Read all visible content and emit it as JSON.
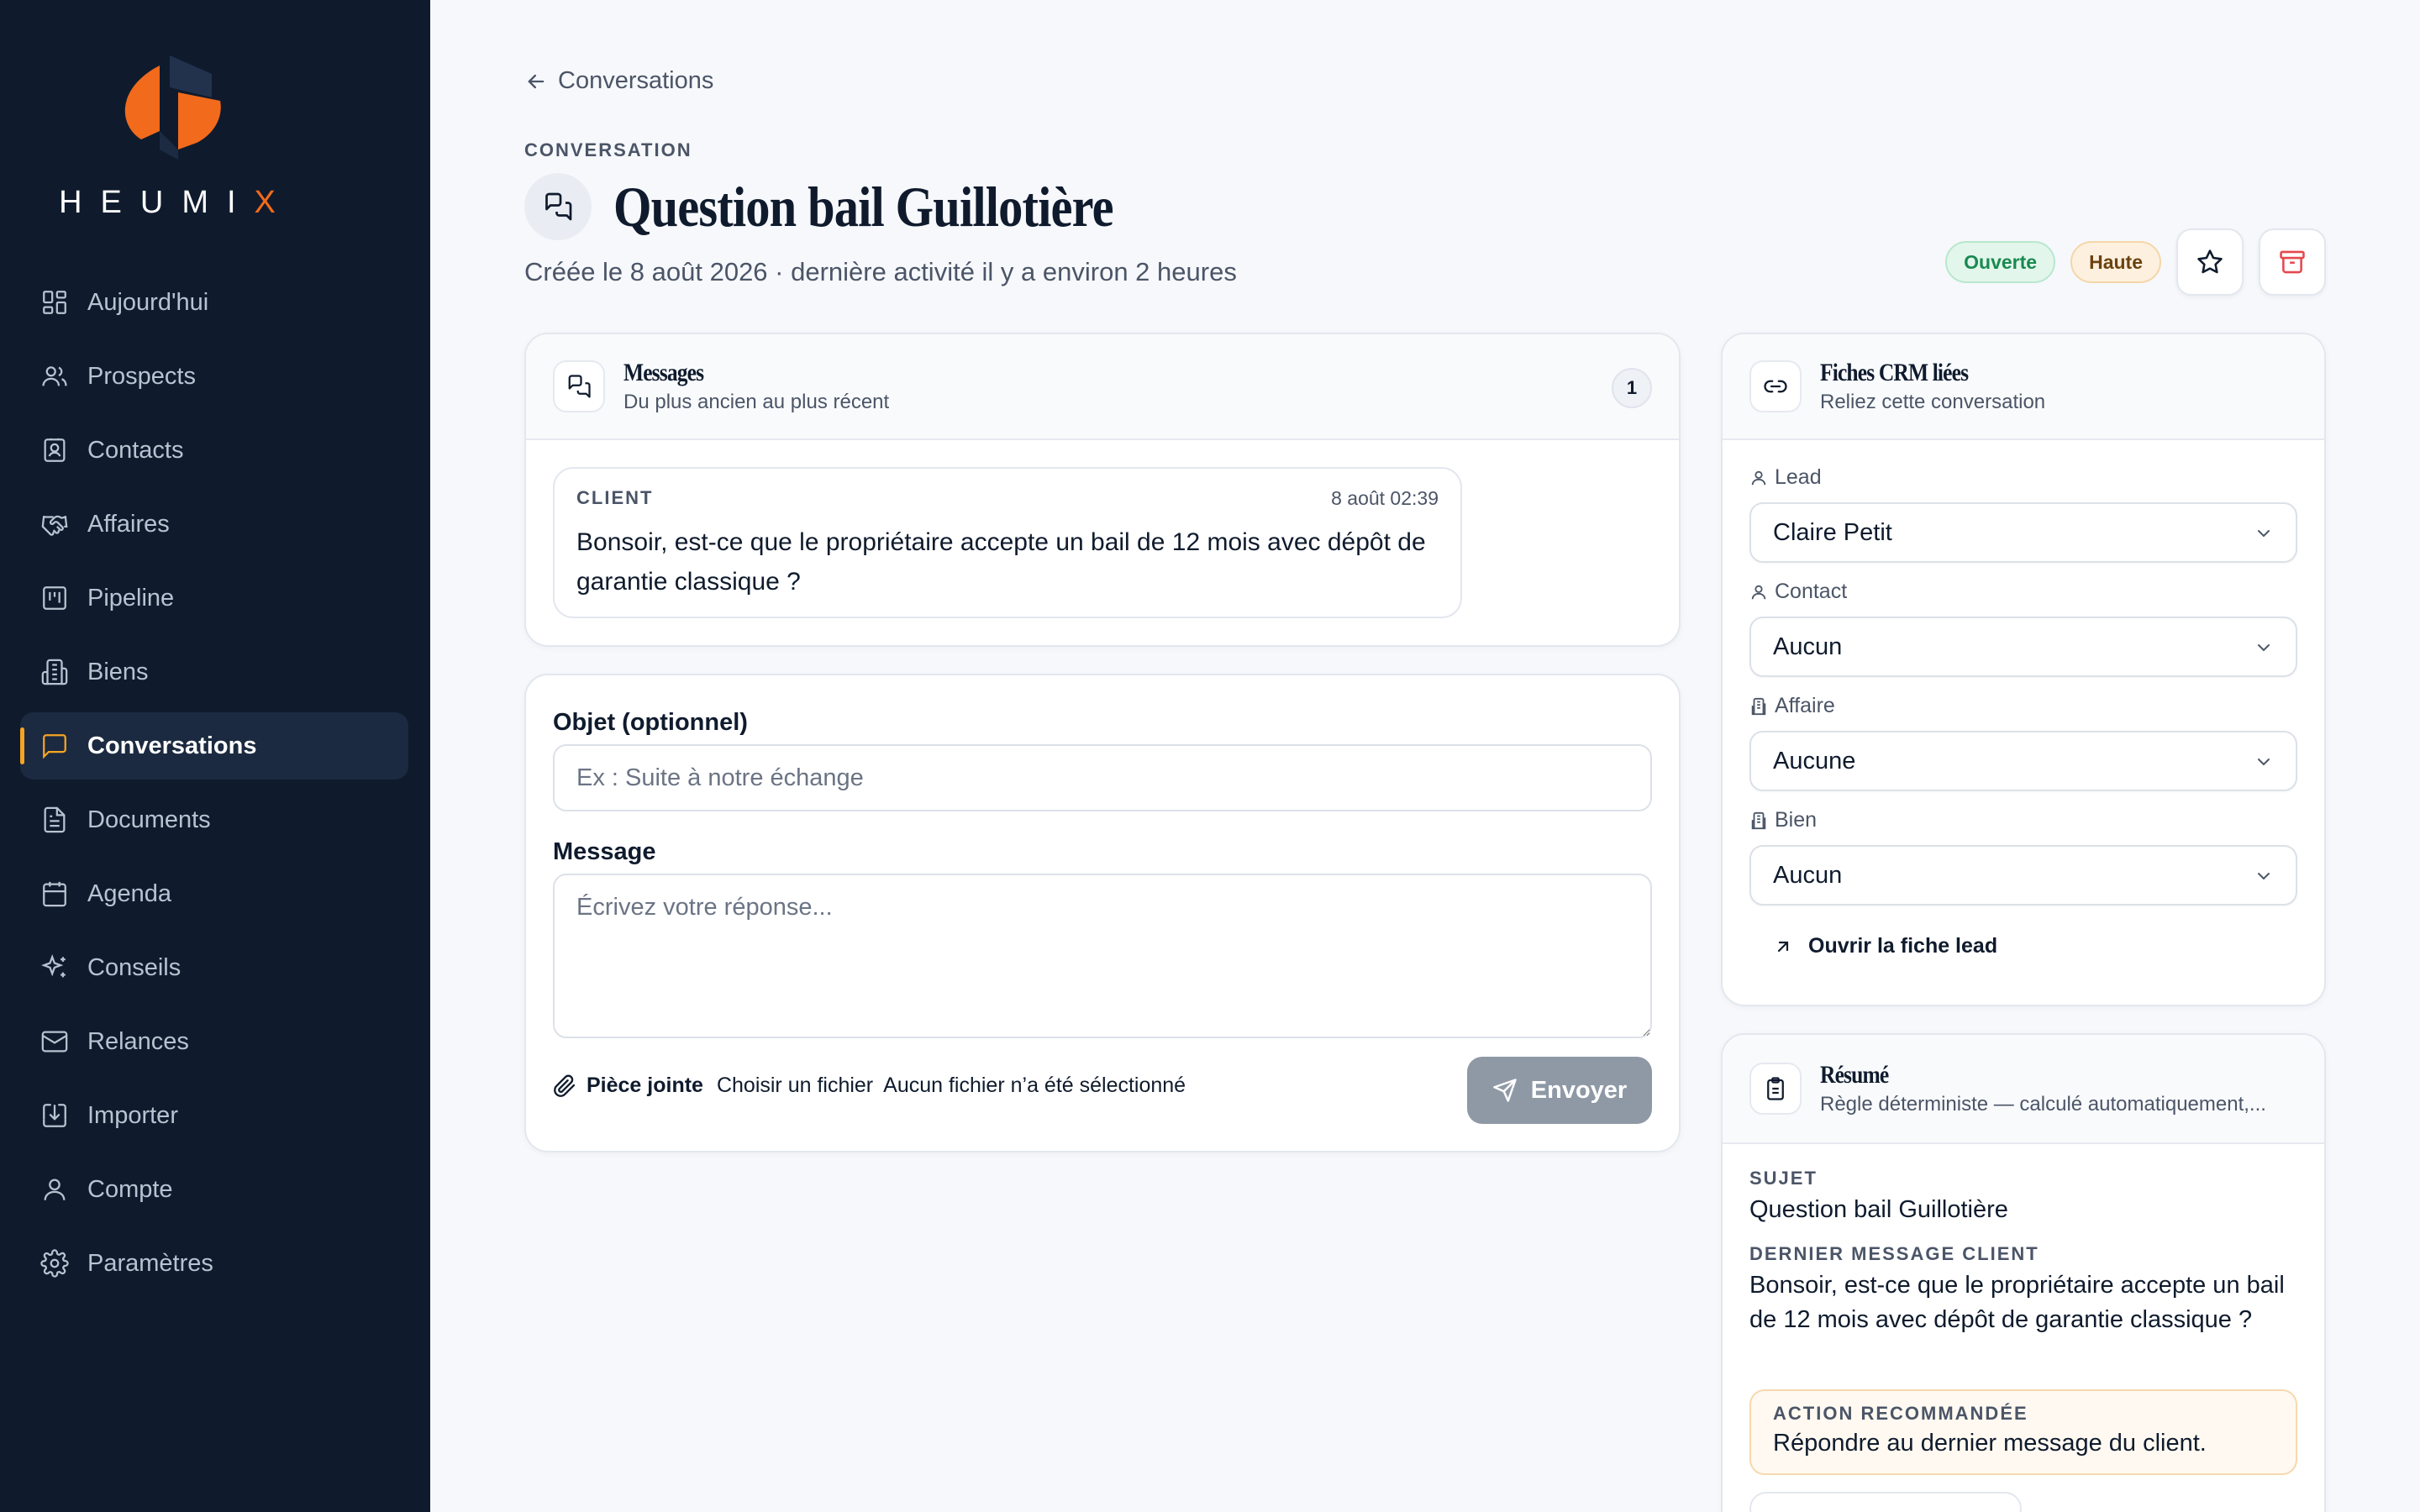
{
  "brand": {
    "name_main": "HEUMI",
    "name_accent": "X",
    "accent_color": "#f26a1b"
  },
  "sidebar": {
    "items": [
      {
        "label": "Aujourd'hui",
        "icon": "dashboard-icon",
        "active": false
      },
      {
        "label": "Prospects",
        "icon": "users-icon",
        "active": false
      },
      {
        "label": "Contacts",
        "icon": "contact-card-icon",
        "active": false
      },
      {
        "label": "Affaires",
        "icon": "handshake-icon",
        "active": false
      },
      {
        "label": "Pipeline",
        "icon": "kanban-icon",
        "active": false
      },
      {
        "label": "Biens",
        "icon": "building-icon",
        "active": false
      },
      {
        "label": "Conversations",
        "icon": "chat-icon",
        "active": true
      },
      {
        "label": "Documents",
        "icon": "document-icon",
        "active": false
      },
      {
        "label": "Agenda",
        "icon": "calendar-icon",
        "active": false
      },
      {
        "label": "Conseils",
        "icon": "sparkles-icon",
        "active": false
      },
      {
        "label": "Relances",
        "icon": "mail-icon",
        "active": false
      },
      {
        "label": "Importer",
        "icon": "import-icon",
        "active": false
      },
      {
        "label": "Compte",
        "icon": "user-icon",
        "active": false
      },
      {
        "label": "Paramètres",
        "icon": "gear-icon",
        "active": false
      }
    ]
  },
  "header": {
    "back_label": "Conversations",
    "eyebrow": "CONVERSATION",
    "title": "Question bail Guillotière",
    "subtitle": "Créée le 8 août 2026 · dernière activité il y a environ 2 heures",
    "status_badge": "Ouverte",
    "priority_badge": "Haute"
  },
  "messages": {
    "title": "Messages",
    "subtitle": "Du plus ancien au plus récent",
    "count": "1",
    "items": [
      {
        "sender": "CLIENT",
        "time": "8 août 02:39",
        "text": "Bonsoir, est-ce que le propriétaire accepte un bail de 12 mois avec dépôt de garantie classique ?"
      }
    ]
  },
  "reply": {
    "subject_label": "Objet (optionnel)",
    "subject_placeholder": "Ex : Suite à notre échange",
    "subject_value": "",
    "message_label": "Message",
    "message_placeholder": "Écrivez votre réponse...",
    "attachment_label": "Pièce jointe",
    "choose_file": "Choisir un fichier",
    "no_file": "Aucun fichier n’a été sélectionné",
    "send_label": "Envoyer"
  },
  "crm": {
    "title": "Fiches CRM liées",
    "subtitle": "Reliez cette conversation",
    "lead_label": "Lead",
    "lead_value": "Claire Petit",
    "contact_label": "Contact",
    "contact_value": "Aucun",
    "deal_label": "Affaire",
    "deal_value": "Aucune",
    "property_label": "Bien",
    "property_value": "Aucun",
    "open_lead": "Ouvrir la fiche lead"
  },
  "summary": {
    "title": "Résumé",
    "subtitle": "Règle déterministe — calculé automatiquement,...",
    "subject_label": "SUJET",
    "subject_value": "Question bail Guillotière",
    "last_message_label": "DERNIER MESSAGE CLIENT",
    "last_message_value": "Bonsoir, est-ce que le propriétaire accepte un bail de 12 mois avec dépôt de garantie classique ?",
    "action_label": "ACTION RECOMMANDÉE",
    "action_value": "Répondre au dernier message du client."
  },
  "colors": {
    "sidebar_bg": "#0f1b2d",
    "active_indicator": "#f5a524",
    "open_green": "#198a51",
    "archive_red": "#e5484d",
    "send_disabled": "#8f99a6"
  }
}
